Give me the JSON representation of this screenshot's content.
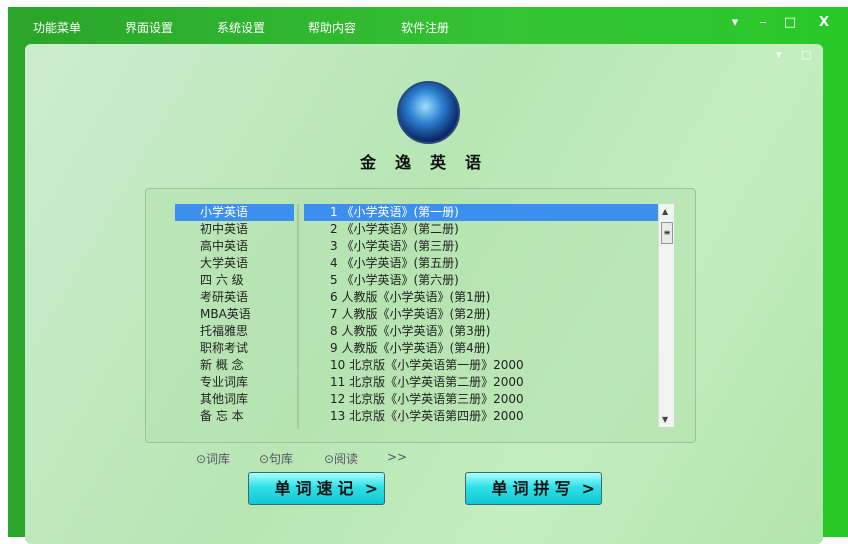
{
  "menu": [
    "功能菜单",
    "界面设置",
    "系统设置",
    "帮助内容",
    "软件注册"
  ],
  "window": {
    "dropdown": "▾",
    "minimize": "–",
    "maximize": "□",
    "close": "X"
  },
  "app_title": "金逸英语",
  "categories": [
    "小学英语",
    "初中英语",
    "高中英语",
    "大学英语",
    "四 六 级",
    "考研英语",
    "MBA英语",
    "托福雅思",
    "职称考试",
    "新 概 念",
    "专业词库",
    "其他词库",
    "备 忘 本"
  ],
  "books": [
    "1 《小学英语》(第一册)",
    "2 《小学英语》(第二册)",
    "3 《小学英语》(第三册)",
    "4 《小学英语》(第五册)",
    "5 《小学英语》(第六册)",
    "6 人教版《小学英语》(第1册)",
    "7 人教版《小学英语》(第2册)",
    "8 人教版《小学英语》(第3册)",
    "9 人教版《小学英语》(第4册)",
    "10 北京版《小学英语第一册》2000",
    "11 北京版《小学英语第二册》2000",
    "12 北京版《小学英语第三册》2000",
    "13 北京版《小学英语第四册》2000"
  ],
  "options": [
    "⊙词库",
    "⊙句库",
    "⊙阅读",
    ">>"
  ],
  "buttons": {
    "memorize": "单词速记",
    "spell": "单词拼写",
    "chevron": ">"
  }
}
